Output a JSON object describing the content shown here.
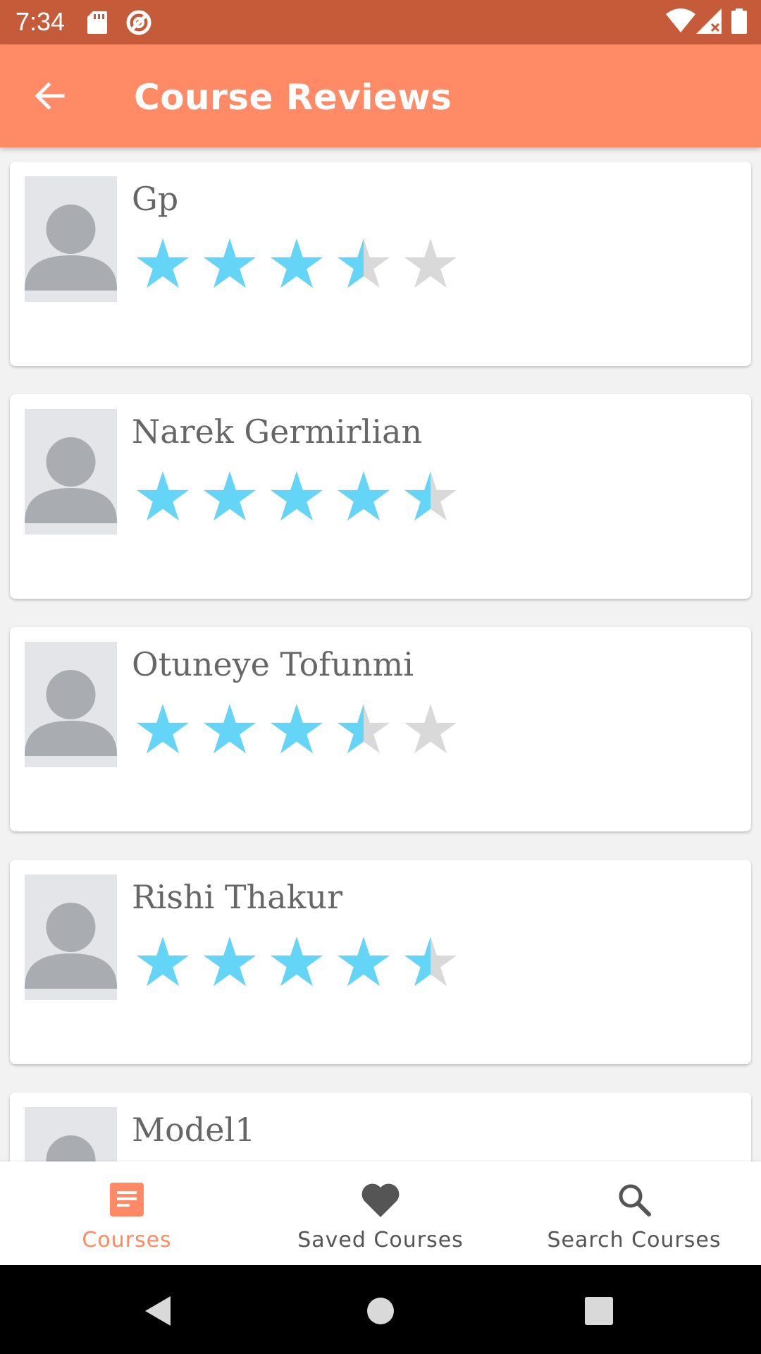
{
  "status_bar": {
    "time": "7:34",
    "icons": [
      "sd-card-icon",
      "no-tracking-icon",
      "wifi-icon",
      "signal-icon",
      "battery-icon"
    ]
  },
  "app_bar": {
    "title": "Course Reviews",
    "back_icon": "arrow-back-icon"
  },
  "reviews": [
    {
      "name": "Gp",
      "rating": 3.5
    },
    {
      "name": "Narek Germirlian",
      "rating": 4.5
    },
    {
      "name": "Otuneye Tofunmi",
      "rating": 3.5
    },
    {
      "name": "Rishi Thakur",
      "rating": 4.5
    },
    {
      "name": "Model1",
      "rating": null
    }
  ],
  "bottom_nav": {
    "items": [
      {
        "label": "Courses",
        "icon": "list-icon",
        "active": true
      },
      {
        "label": "Saved Courses",
        "icon": "heart-icon",
        "active": false
      },
      {
        "label": "Search Courses",
        "icon": "search-icon",
        "active": false
      }
    ]
  },
  "colors": {
    "status_bar": "#c65b3a",
    "app_bar": "#ff8a65",
    "accent": "#ff8a65",
    "star_filled": "#64d4f7",
    "star_empty": "#d9d9d9",
    "nav_inactive": "#555555"
  },
  "system_nav": [
    "back-triangle-icon",
    "home-circle-icon",
    "recents-square-icon"
  ]
}
